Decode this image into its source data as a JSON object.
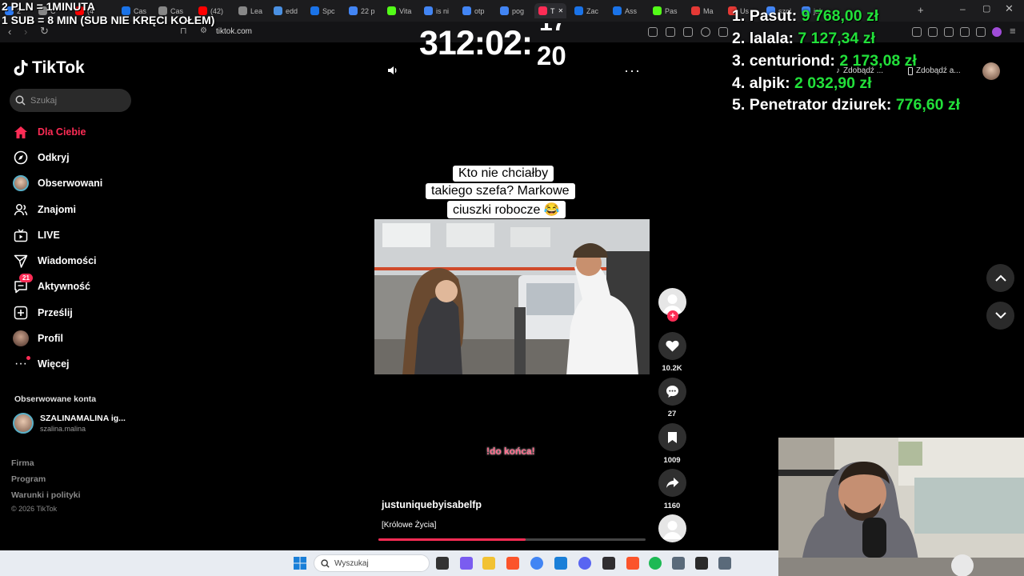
{
  "browser": {
    "tabs": [
      {
        "label": "2",
        "fav": "#2d7cf6"
      },
      {
        "label": "C",
        "fav": "#888"
      },
      {
        "label": "(4",
        "fav": "#ff0000"
      },
      {
        "label": "Cas",
        "fav": "#1a73e8"
      },
      {
        "label": "Cas",
        "fav": "#888"
      },
      {
        "label": "(42)",
        "fav": "#ff0000"
      },
      {
        "label": "Lea",
        "fav": "#888"
      },
      {
        "label": "edd",
        "fav": "#4a90e2"
      },
      {
        "label": "Spc",
        "fav": "#1a73e8"
      },
      {
        "label": "22 p",
        "fav": "#4285f4"
      },
      {
        "label": "Vita",
        "fav": "#53fc18"
      },
      {
        "label": "is ni",
        "fav": "#4285f4"
      },
      {
        "label": "otp",
        "fav": "#4285f4"
      },
      {
        "label": "pog",
        "fav": "#4285f4"
      },
      {
        "label": "T",
        "fav": "#fe2c55"
      },
      {
        "label": "Zac",
        "fav": "#1a73e8"
      },
      {
        "label": "Ass",
        "fav": "#1a73e8"
      },
      {
        "label": "Pas",
        "fav": "#53fc18"
      },
      {
        "label": "Ma",
        "fav": "#e53935"
      },
      {
        "label": "Us",
        "fav": "#e53935"
      },
      {
        "label": "szol",
        "fav": "#4285f4"
      },
      {
        "label": "jak",
        "fav": "#4285f4"
      }
    ],
    "url": "tiktok.com",
    "get_app_1": "Zdobądź ...",
    "get_app_2": "Zdobądź a..."
  },
  "overlay": {
    "line1": "2 PLN = 1MINUTA",
    "line2": "1 SUB = 8 MIN (SUB NIE KRĘCI KOŁEM)",
    "timer_main": "312:02:",
    "timer_sec_top": "17",
    "timer_sec_bottom": "20"
  },
  "leaderboard": [
    {
      "rank": "1.",
      "name": "Pasut:",
      "amount": "9 768,00 zł"
    },
    {
      "rank": "2.",
      "name": "lalala:",
      "amount": "7 127,34 zł"
    },
    {
      "rank": "3.",
      "name": "centuriond:",
      "amount": "2 173,08 zł"
    },
    {
      "rank": "4.",
      "name": "alpik:",
      "amount": "2 032,90 zł"
    },
    {
      "rank": "5.",
      "name": "Penetrator dziurek:",
      "amount": "776,60 zł"
    }
  ],
  "sidebar": {
    "logo": "TikTok",
    "search_placeholder": "Szukaj",
    "items": [
      {
        "label": "Dla Ciebie",
        "icon": "home-icon"
      },
      {
        "label": "Odkryj",
        "icon": "compass-icon"
      },
      {
        "label": "Obserwowani",
        "icon": "following-avatar-icon"
      },
      {
        "label": "Znajomi",
        "icon": "friends-icon"
      },
      {
        "label": "LIVE",
        "icon": "live-icon"
      },
      {
        "label": "Wiadomości",
        "icon": "send-icon"
      },
      {
        "label": "Aktywność",
        "icon": "activity-icon",
        "badge": "21"
      },
      {
        "label": "Prześlij",
        "icon": "upload-icon"
      },
      {
        "label": "Profil",
        "icon": "profile-avatar-icon"
      },
      {
        "label": "Więcej",
        "icon": "more-icon"
      }
    ],
    "followed_heading": "Obserwowane konta",
    "followed_account": {
      "name": "SZALINAMALINA ig...",
      "handle": "szalina.malina"
    },
    "footer": [
      "Firma",
      "Program",
      "Warunki i polityki"
    ],
    "copyright": "© 2026 TikTok"
  },
  "video": {
    "caption_lines": [
      "Kto nie chciałby",
      "takiego szefa? Markowe",
      "ciuszki robocze 😂"
    ],
    "overlay_text": "!do końca!",
    "author": "justuniquebyisabelfp",
    "description": "[Królowe Życia]",
    "progress": 0.55,
    "likes": "10.2K",
    "comments": "27",
    "saves": "1009",
    "shares": "1160"
  },
  "taskbar": {
    "search_placeholder": "Wyszukaj"
  },
  "colors": {
    "accent": "#fe2c55",
    "leaderboard_amount": "#22e03a"
  }
}
